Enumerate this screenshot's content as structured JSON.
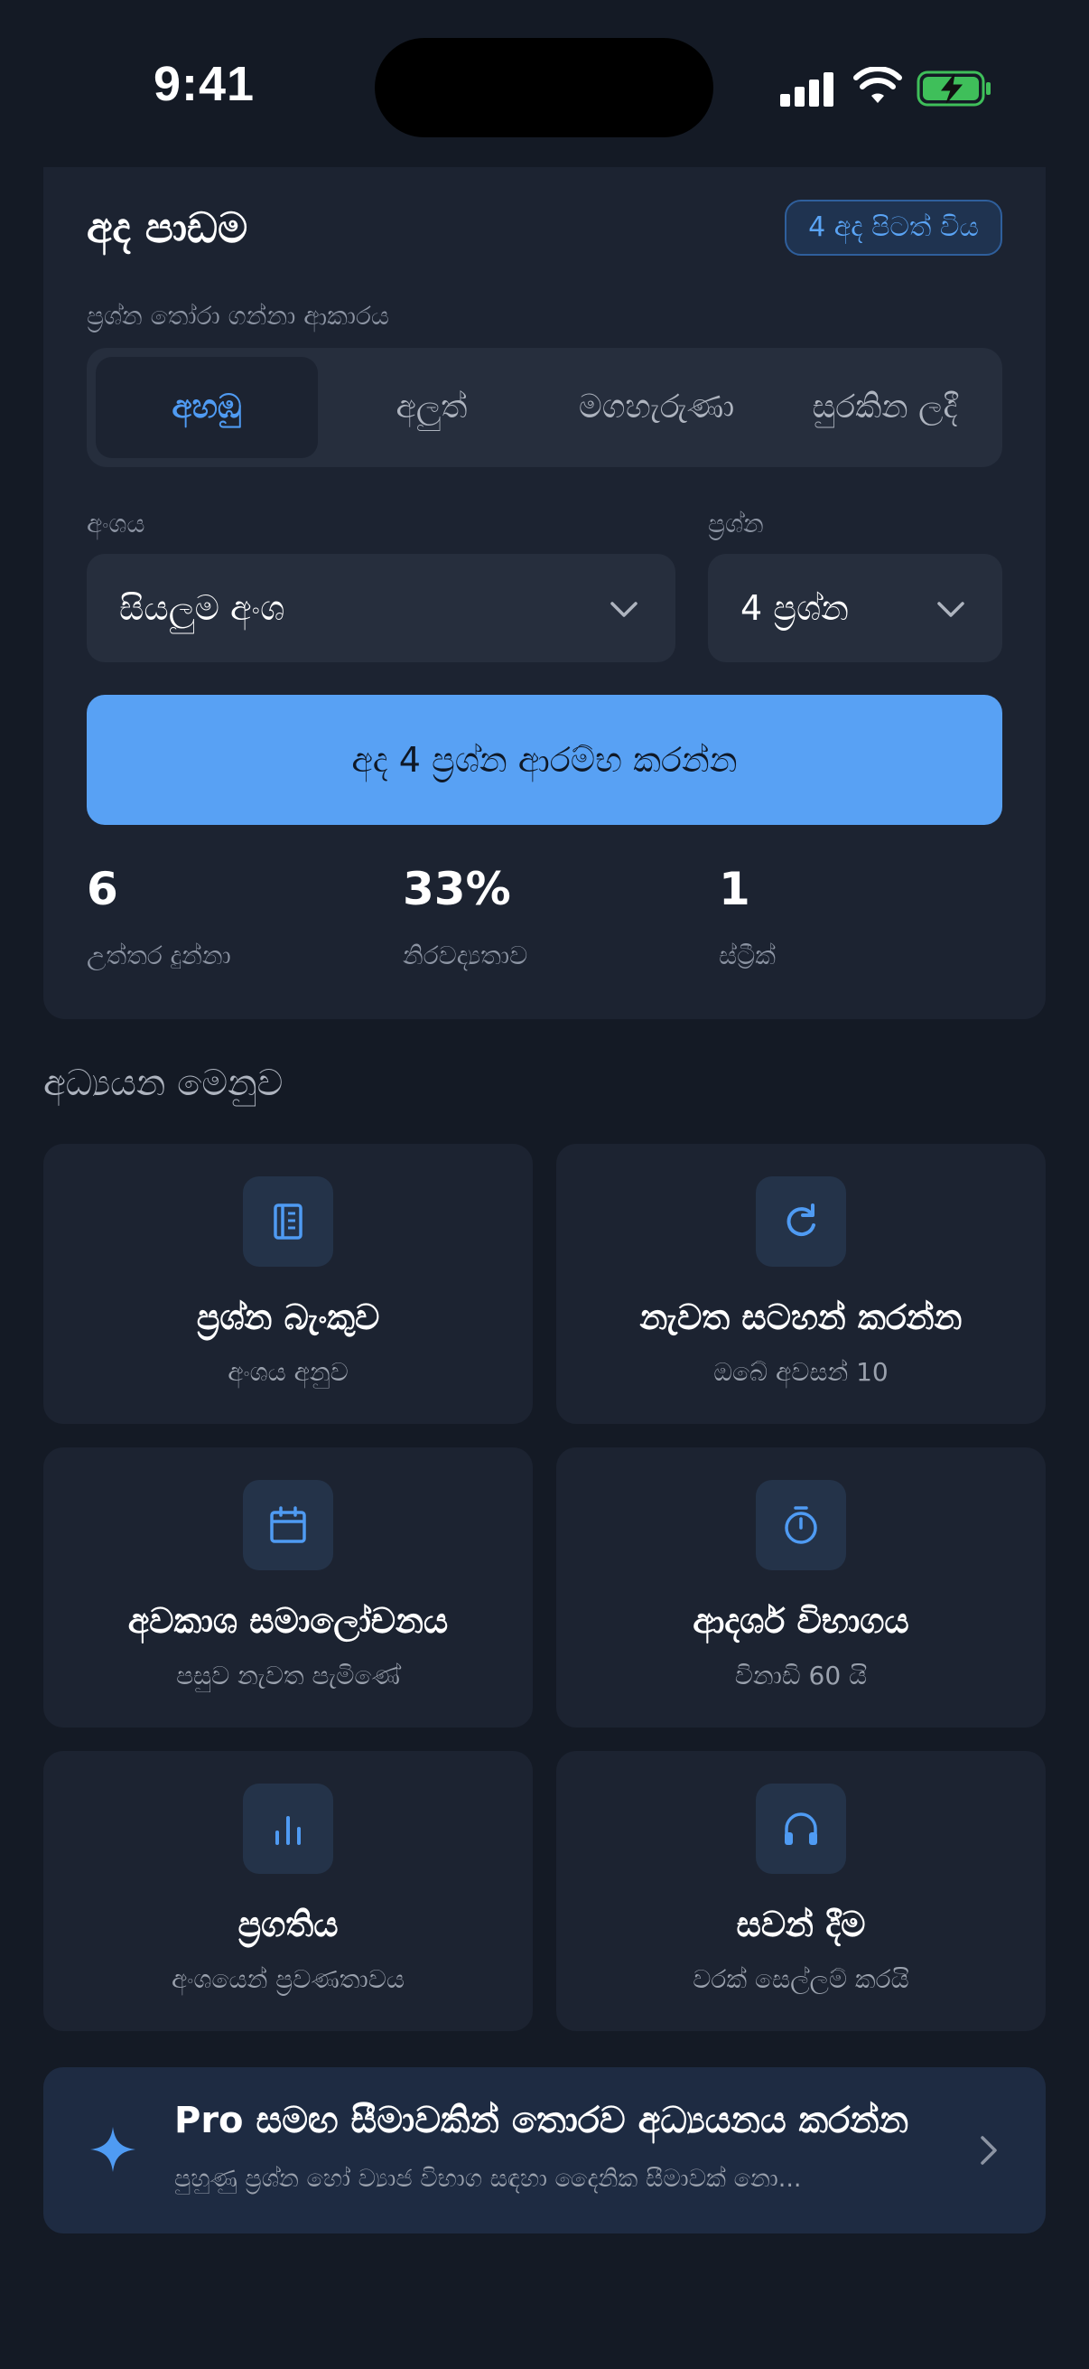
{
  "status_bar": {
    "time": "9:41"
  },
  "today": {
    "title": "අද පාඩම",
    "badge": "4 අද පිටත් විය",
    "mode_label": "ප්‍රශ්න තෝරා ගන්නා ආකාරය",
    "modes": [
      {
        "label": "අහඹු",
        "active": true
      },
      {
        "label": "අලුත්",
        "active": false
      },
      {
        "label": "මගහැරුණා",
        "active": false
      },
      {
        "label": "සුරකින ලදී",
        "active": false
      }
    ],
    "subject_label": "අංශය",
    "subject_value": "සියලුම අංශ",
    "count_label": "ප්‍රශ්න",
    "count_value": "4 ප්‍රශ්න",
    "start_button": "අද 4 ප්‍රශ්න ආරම්භ කරන්න",
    "stats": [
      {
        "value": "6",
        "label": "උත්තර දුන්නා"
      },
      {
        "value": "33%",
        "label": "නිරවද්‍යතාව"
      },
      {
        "value": "1",
        "label": "ස්ට්‍රීක්"
      }
    ]
  },
  "menu": {
    "title": "අධ්‍යයන මෙනුව",
    "items": [
      {
        "title": "ප්‍රශ්න බැංකුව",
        "subtitle": "අංශය අනුව",
        "icon": "book-icon"
      },
      {
        "title": "නැවත සටහන් කරන්න",
        "subtitle": "ඔබේ අවසන් 10",
        "icon": "refresh-icon"
      },
      {
        "title": "අවකාශ සමාලෝචනය",
        "subtitle": "පසුව නැවත පැමිණේ",
        "icon": "calendar-icon"
      },
      {
        "title": "ආදර්ශ විභාගය",
        "subtitle": "විනාඩි 60 යි",
        "icon": "stopwatch-icon"
      },
      {
        "title": "ප්‍රගතිය",
        "subtitle": "අංශයෙන් ප්‍රවණතාවය",
        "icon": "bar-chart-icon"
      },
      {
        "title": "සවන් දීම",
        "subtitle": "වරක් සෙල්ලම් කරයි",
        "icon": "headphones-icon"
      }
    ]
  },
  "pro": {
    "title": "Pro සමඟ සීමාවකින් තොරව අධ්‍යයනය කරන්න",
    "subtitle": "පුහුණු ප්‍රශ්න හෝ ව්‍යාජ විභාග සඳහා දෛනික සීමාවක් නො..."
  },
  "colors": {
    "background": "#141a25",
    "card": "#1c2331",
    "accent": "#58a1f4",
    "icon_box": "#243349"
  }
}
